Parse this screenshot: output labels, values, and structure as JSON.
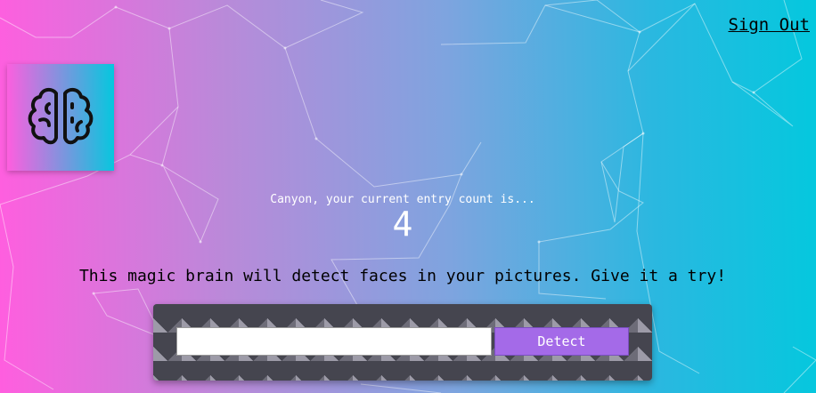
{
  "nav": {
    "sign_out_label": "Sign Out"
  },
  "logo": {
    "icon": "brain-icon"
  },
  "rank": {
    "label": "Canyon, your current entry count is...",
    "count": "4"
  },
  "tagline": "This magic brain will detect faces in your pictures. Give it a try!",
  "form": {
    "input_value": "",
    "input_placeholder": "",
    "detect_label": "Detect"
  },
  "colors": {
    "gradient_start": "#ff5edf",
    "gradient_end": "#04c8de",
    "button": "#a46ae8"
  }
}
